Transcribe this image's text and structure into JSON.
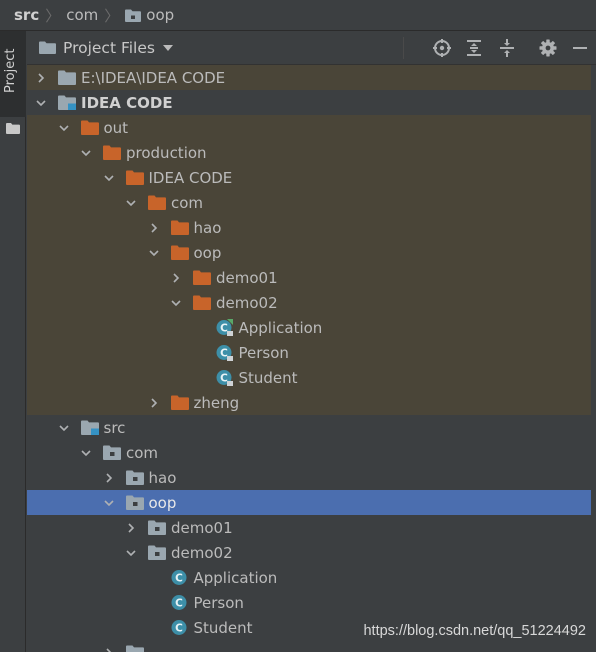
{
  "colors": {
    "background": "#3c3f41",
    "excluded_bg": "#4a4538",
    "selected_bg": "#4b6eaf",
    "folder_orange": "#c8642a",
    "folder_gray": "#9aa7b0",
    "class_teal": "#3d8fa8"
  },
  "breadcrumb": [
    "src",
    "com",
    "oop"
  ],
  "sidebar": {
    "tab_label": "Project"
  },
  "panel": {
    "title": "Project Files"
  },
  "tree": [
    {
      "label": "E:\\IDEA\\IDEA CODE",
      "indent": 0,
      "arrow": "right",
      "icon": "folder-gray",
      "excluded": true
    },
    {
      "label": "IDEA CODE",
      "indent": 0,
      "arrow": "down",
      "icon": "module-folder",
      "excluded": false,
      "bold": true
    },
    {
      "label": "out",
      "indent": 1,
      "arrow": "down",
      "icon": "folder-orange",
      "excluded": true
    },
    {
      "label": "production",
      "indent": 2,
      "arrow": "down",
      "icon": "folder-orange",
      "excluded": true
    },
    {
      "label": "IDEA CODE",
      "indent": 3,
      "arrow": "down",
      "icon": "folder-orange",
      "excluded": true
    },
    {
      "label": "com",
      "indent": 4,
      "arrow": "down",
      "icon": "folder-orange",
      "excluded": true
    },
    {
      "label": "hao",
      "indent": 5,
      "arrow": "right",
      "icon": "folder-orange",
      "excluded": true
    },
    {
      "label": "oop",
      "indent": 5,
      "arrow": "down",
      "icon": "folder-orange",
      "excluded": true
    },
    {
      "label": "demo01",
      "indent": 6,
      "arrow": "right",
      "icon": "folder-orange",
      "excluded": true
    },
    {
      "label": "demo02",
      "indent": 6,
      "arrow": "down",
      "icon": "folder-orange",
      "excluded": true
    },
    {
      "label": "Application",
      "indent": 7,
      "arrow": "none",
      "icon": "class-main",
      "excluded": true
    },
    {
      "label": "Person",
      "indent": 7,
      "arrow": "none",
      "icon": "class-compiled",
      "excluded": true
    },
    {
      "label": "Student",
      "indent": 7,
      "arrow": "none",
      "icon": "class-compiled",
      "excluded": true
    },
    {
      "label": "zheng",
      "indent": 5,
      "arrow": "right",
      "icon": "folder-orange",
      "excluded": true
    },
    {
      "label": "src",
      "indent": 1,
      "arrow": "down",
      "icon": "source-folder",
      "excluded": false
    },
    {
      "label": "com",
      "indent": 2,
      "arrow": "down",
      "icon": "package-folder",
      "excluded": false
    },
    {
      "label": "hao",
      "indent": 3,
      "arrow": "right",
      "icon": "package-folder",
      "excluded": false
    },
    {
      "label": "oop",
      "indent": 3,
      "arrow": "down",
      "icon": "package-folder",
      "excluded": false,
      "selected": true
    },
    {
      "label": "demo01",
      "indent": 4,
      "arrow": "right",
      "icon": "package-folder",
      "excluded": false
    },
    {
      "label": "demo02",
      "indent": 4,
      "arrow": "down",
      "icon": "package-folder",
      "excluded": false
    },
    {
      "label": "Application",
      "indent": 5,
      "arrow": "none",
      "icon": "class",
      "excluded": false
    },
    {
      "label": "Person",
      "indent": 5,
      "arrow": "none",
      "icon": "class",
      "excluded": false
    },
    {
      "label": "Student",
      "indent": 5,
      "arrow": "none",
      "icon": "class",
      "excluded": false
    },
    {
      "label": "",
      "indent": 3,
      "arrow": "right",
      "icon": "package-folder",
      "excluded": false
    }
  ],
  "watermark": "https://blog.csdn.net/qq_51224492"
}
